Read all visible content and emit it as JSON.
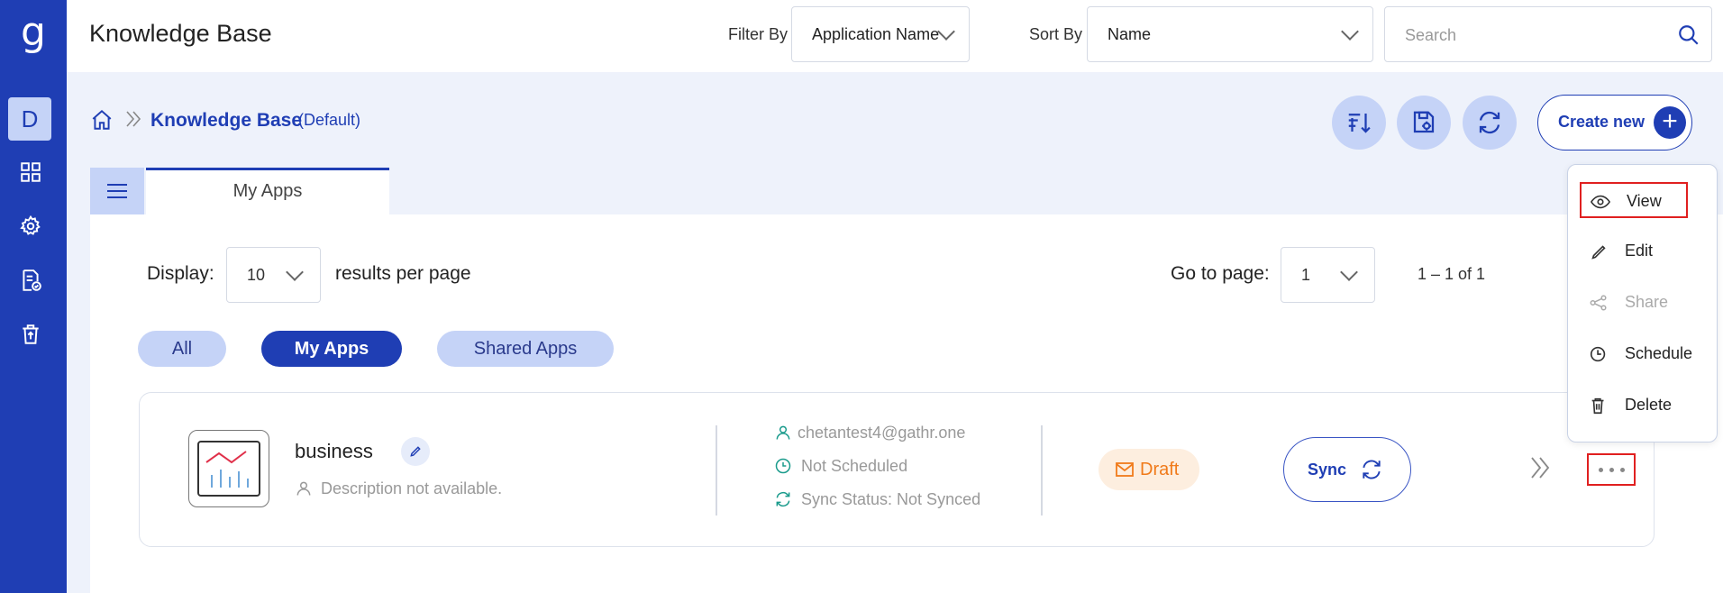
{
  "brand": {
    "logo": "g"
  },
  "sidebar": {
    "avatar_letter": "D"
  },
  "header": {
    "title": "Knowledge Base",
    "filter_by_label": "Filter By",
    "filter_by_value": "Application Name",
    "sort_by_label": "Sort By",
    "sort_by_value": "Name",
    "search_placeholder": "Search"
  },
  "breadcrumb": {
    "title": "Knowledge Base",
    "subtitle": "(Default)"
  },
  "actions": {
    "create_label": "Create new"
  },
  "tabs": {
    "active": "My Apps"
  },
  "pagination": {
    "display_label": "Display:",
    "display_value": "10",
    "per_page_label": "results per page",
    "goto_label": "Go to page:",
    "page_value": "1",
    "range_text": "1 – 1 of 1"
  },
  "filters": {
    "all": "All",
    "my_apps": "My Apps",
    "shared_apps": "Shared Apps",
    "active": "My Apps"
  },
  "app_card": {
    "name": "business",
    "description": "Description not available.",
    "owner": "chetantest4@gathr.one",
    "schedule": "Not Scheduled",
    "sync_status": "Sync Status: Not Synced",
    "status_badge": "Draft",
    "sync_button": "Sync"
  },
  "context_menu": {
    "items": [
      {
        "label": "View",
        "icon": "eye-icon",
        "enabled": true,
        "highlighted": true
      },
      {
        "label": "Edit",
        "icon": "pencil-icon",
        "enabled": true
      },
      {
        "label": "Share",
        "icon": "share-icon",
        "enabled": false
      },
      {
        "label": "Schedule",
        "icon": "clock-icon",
        "enabled": true
      },
      {
        "label": "Delete",
        "icon": "trash-icon",
        "enabled": true
      }
    ]
  },
  "colors": {
    "primary": "#1f3eb4",
    "primary_light": "#c5d3f7",
    "teal": "#1a9b8c",
    "draft": "#f07a1a",
    "highlight": "#e02020"
  }
}
